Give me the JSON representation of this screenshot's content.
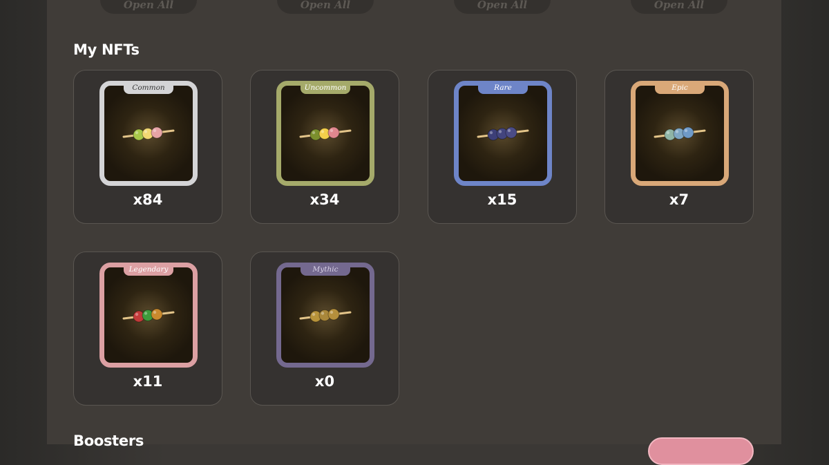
{
  "top_buttons": [
    {
      "label": "Open All"
    },
    {
      "label": "Open All"
    },
    {
      "label": "Open All"
    },
    {
      "label": "Open All"
    }
  ],
  "nfts": {
    "title": "My NFTs",
    "items": [
      {
        "rarity": "Common",
        "count": "x84",
        "frame": "#d4d4d6",
        "tab_text": "#3a3a3a",
        "balls": [
          "#a8c84a",
          "#f2d873",
          "#e6a4a6"
        ]
      },
      {
        "rarity": "Uncommon",
        "count": "x34",
        "frame": "#a5aa6a",
        "tab_text": "#ffffff",
        "balls": [
          "#7b8f2d",
          "#f4cf4b",
          "#e0878e"
        ]
      },
      {
        "rarity": "Rare",
        "count": "x15",
        "frame": "#6e85c8",
        "tab_text": "#ffffff",
        "balls": [
          "#3d3f78",
          "#43457e",
          "#4b4c86"
        ]
      },
      {
        "rarity": "Epic",
        "count": "x7",
        "frame": "#d9a878",
        "tab_text": "#ffffff",
        "balls": [
          "#8fb5a6",
          "#7fa7c4",
          "#6f9ac8"
        ]
      },
      {
        "rarity": "Legendary",
        "count": "x11",
        "frame": "#dca0a3",
        "tab_text": "#ffffff",
        "balls": [
          "#c23a3a",
          "#3f9b3c",
          "#c98a2e"
        ]
      },
      {
        "rarity": "Mythic",
        "count": "x0",
        "frame": "#74698f",
        "tab_text": "#d8d1e6",
        "balls": [
          "#b8933a",
          "#a9873a",
          "#b58f3c"
        ]
      }
    ]
  },
  "boosters": {
    "title": "Boosters"
  }
}
